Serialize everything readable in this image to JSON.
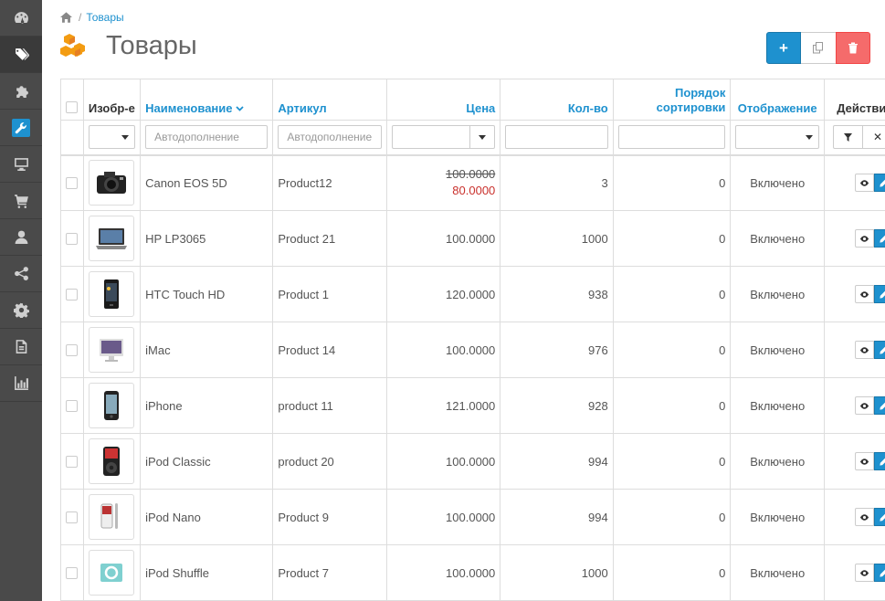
{
  "sidebar": {
    "items": [
      {
        "icon": "dashboard-icon"
      },
      {
        "icon": "tags-icon"
      },
      {
        "icon": "puzzle-icon"
      },
      {
        "icon": "wrench-icon"
      },
      {
        "icon": "desktop-icon"
      },
      {
        "icon": "cart-icon"
      },
      {
        "icon": "user-icon"
      },
      {
        "icon": "share-icon"
      },
      {
        "icon": "cog-icon"
      },
      {
        "icon": "file-icon"
      },
      {
        "icon": "bar-chart-icon"
      }
    ]
  },
  "breadcrumb": {
    "home_icon": "home-icon",
    "current": "Товары"
  },
  "page": {
    "title": "Товары",
    "title_icon": "cubes-icon"
  },
  "colors": {
    "primary": "#1e91cf",
    "danger": "#f56b6b",
    "sidebar": "#4a4a4a",
    "qty_ok": "#3c8a2c",
    "qty_low": "#f0a44f",
    "special_price": "#c9302c"
  },
  "toolbar": {
    "add": "+",
    "copy_icon": "copy-icon",
    "delete_icon": "trash-icon"
  },
  "table": {
    "headers": {
      "image": "Изобр-е",
      "name": "Наименование",
      "model": "Артикул",
      "price": "Цена",
      "quantity": "Кол-во",
      "sort_line1": "Порядок",
      "sort_line2": "сортировки",
      "status": "Отображение",
      "actions": "Действия"
    },
    "filters": {
      "name_placeholder": "Автодополнение",
      "model_placeholder": "Автодополнение"
    },
    "rows": [
      {
        "name": "Canon EOS 5D",
        "model": "Product12",
        "price": "100.0000",
        "special": "80.0000",
        "quantity": "3",
        "qty_class": "qty-low",
        "sort": "0",
        "status": "Включено",
        "image": "camera"
      },
      {
        "name": "HP LP3065",
        "model": "Product 21",
        "price": "100.0000",
        "special": "",
        "quantity": "1000",
        "qty_class": "qty-ok",
        "sort": "0",
        "status": "Включено",
        "image": "laptop"
      },
      {
        "name": "HTC Touch HD",
        "model": "Product 1",
        "price": "120.0000",
        "special": "",
        "quantity": "938",
        "qty_class": "qty-ok",
        "sort": "0",
        "status": "Включено",
        "image": "phone"
      },
      {
        "name": "iMac",
        "model": "Product 14",
        "price": "100.0000",
        "special": "",
        "quantity": "976",
        "qty_class": "qty-ok",
        "sort": "0",
        "status": "Включено",
        "image": "imac"
      },
      {
        "name": "iPhone",
        "model": "product 11",
        "price": "121.0000",
        "special": "",
        "quantity": "928",
        "qty_class": "qty-ok",
        "sort": "0",
        "status": "Включено",
        "image": "iphone"
      },
      {
        "name": "iPod Classic",
        "model": "product 20",
        "price": "100.0000",
        "special": "",
        "quantity": "994",
        "qty_class": "qty-ok",
        "sort": "0",
        "status": "Включено",
        "image": "ipod-classic"
      },
      {
        "name": "iPod Nano",
        "model": "Product 9",
        "price": "100.0000",
        "special": "",
        "quantity": "994",
        "qty_class": "qty-ok",
        "sort": "0",
        "status": "Включено",
        "image": "ipod-nano"
      },
      {
        "name": "iPod Shuffle",
        "model": "Product 7",
        "price": "100.0000",
        "special": "",
        "quantity": "1000",
        "qty_class": "qty-ok",
        "sort": "0",
        "status": "Включено",
        "image": "ipod-shuffle"
      }
    ]
  }
}
